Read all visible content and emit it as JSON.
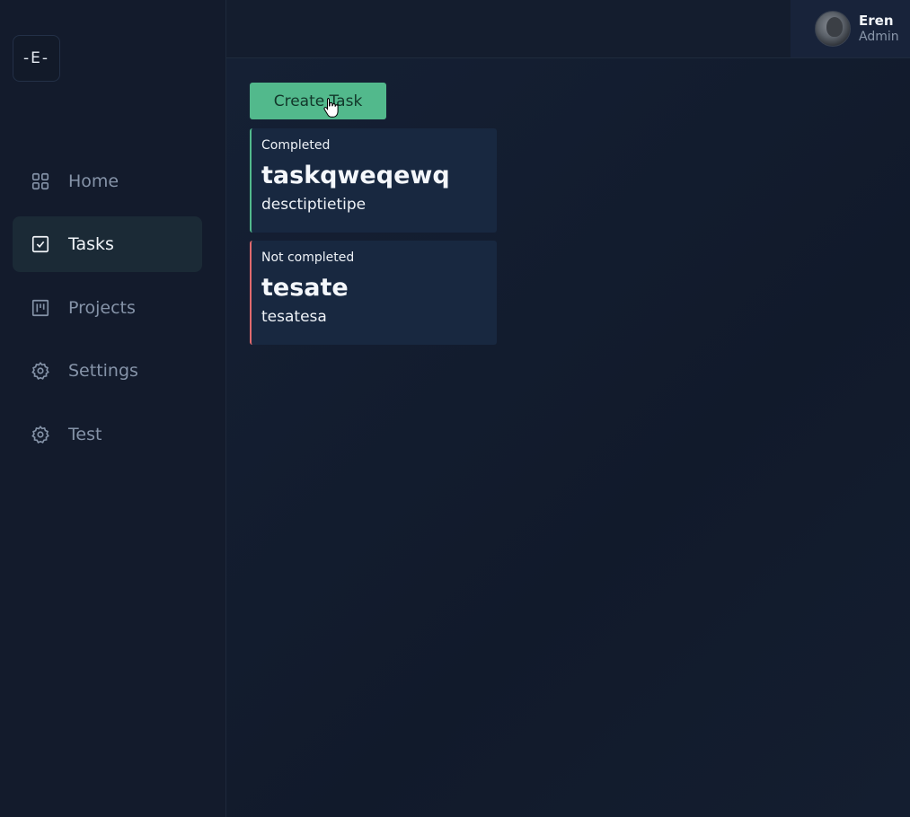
{
  "logo": {
    "text": "-E-"
  },
  "sidebar": {
    "items": [
      {
        "label": "Home",
        "icon": "grid-icon",
        "active": false
      },
      {
        "label": "Tasks",
        "icon": "checkbox-icon",
        "active": true
      },
      {
        "label": "Projects",
        "icon": "kanban-icon",
        "active": false
      },
      {
        "label": "Settings",
        "icon": "gear-icon",
        "active": false
      },
      {
        "label": "Test",
        "icon": "gear-icon",
        "active": false
      }
    ]
  },
  "header": {
    "user": {
      "name": "Eren",
      "role": "Admin"
    }
  },
  "main": {
    "create_button_label": "Create Task",
    "tasks": [
      {
        "status": "Completed",
        "title": "taskqweqewq",
        "description": "desctiptietipe",
        "status_color": "#52b98c"
      },
      {
        "status": "Not completed",
        "title": "tesate",
        "description": "tesatesa",
        "status_color": "#e06a6e"
      }
    ]
  },
  "colors": {
    "accent": "#52b98c",
    "danger": "#e06a6e",
    "background": "#121a2b"
  }
}
